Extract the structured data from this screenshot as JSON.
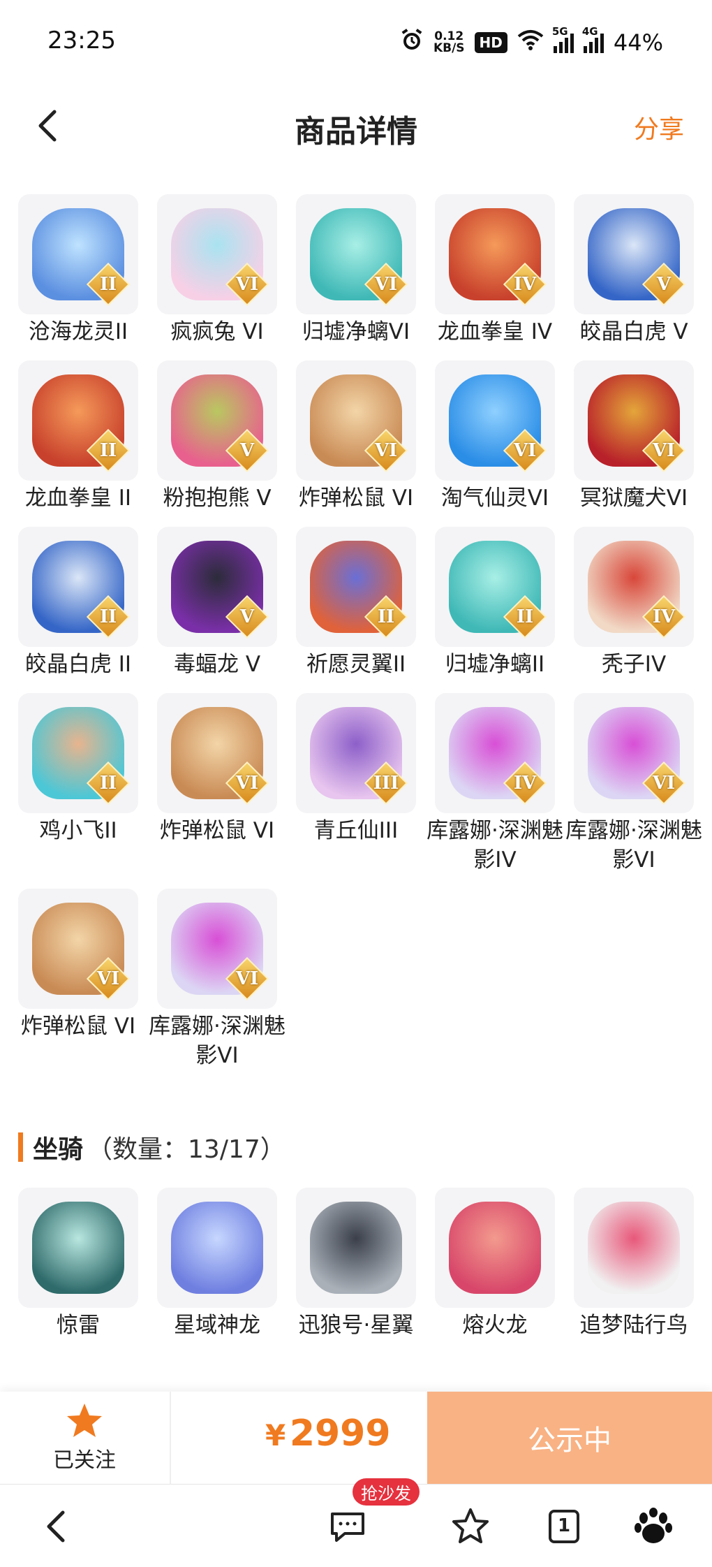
{
  "status_bar": {
    "time": "23:25",
    "net_speed_value": "0.12",
    "net_speed_unit": "KB/S",
    "hd_badge": "HD",
    "sig1_tag": "5G",
    "sig2_tag": "4G",
    "battery": "44%"
  },
  "header": {
    "title": "商品详情",
    "share_label": "分享"
  },
  "items": [
    {
      "label": "沧海龙灵II",
      "rank": "II",
      "colors": [
        "#5b8fe0",
        "#bfe3ff"
      ]
    },
    {
      "label": "疯疯兔 VI",
      "rank": "VI",
      "colors": [
        "#f7d0e6",
        "#a9e3f0"
      ]
    },
    {
      "label": "归墟净螭VI",
      "rank": "VI",
      "colors": [
        "#3fb8b6",
        "#a8efe6"
      ]
    },
    {
      "label": "龙血拳皇 IV",
      "rank": "IV",
      "colors": [
        "#c8412c",
        "#f59a5a"
      ]
    },
    {
      "label": "皎晶白虎 V",
      "rank": "V",
      "colors": [
        "#3566c7",
        "#dbe6f7"
      ]
    },
    {
      "label": "龙血拳皇 II",
      "rank": "II",
      "colors": [
        "#c8412c",
        "#f59a5a"
      ]
    },
    {
      "label": "粉抱抱熊 V",
      "rank": "V",
      "colors": [
        "#e8608e",
        "#b9c860"
      ]
    },
    {
      "label": "炸弹松鼠 VI",
      "rank": "VI",
      "colors": [
        "#c98b55",
        "#f3d5a8"
      ]
    },
    {
      "label": "淘气仙灵VI",
      "rank": "VI",
      "colors": [
        "#2a8de6",
        "#8fd0ff"
      ]
    },
    {
      "label": "冥狱魔犬VI",
      "rank": "VI",
      "colors": [
        "#b8202a",
        "#e4a63a"
      ]
    },
    {
      "label": "皎晶白虎 II",
      "rank": "II",
      "colors": [
        "#3566c7",
        "#dbe6f7"
      ]
    },
    {
      "label": "毒蝠龙 V",
      "rank": "V",
      "colors": [
        "#7a2fa8",
        "#2c2c3a"
      ]
    },
    {
      "label": "祈愿灵翼II",
      "rank": "II",
      "colors": [
        "#e0623a",
        "#6a6fd6"
      ]
    },
    {
      "label": "归墟净螭II",
      "rank": "II",
      "colors": [
        "#3fb8b6",
        "#a8efe6"
      ]
    },
    {
      "label": "秃子IV",
      "rank": "IV",
      "colors": [
        "#f1d9c6",
        "#d8473a"
      ]
    },
    {
      "label": "鸡小飞II",
      "rank": "II",
      "colors": [
        "#4cc7d6",
        "#e8b48e"
      ]
    },
    {
      "label": "炸弹松鼠 VI",
      "rank": "VI",
      "colors": [
        "#c98b55",
        "#f3d5a8"
      ]
    },
    {
      "label": "青丘仙III",
      "rank": "III",
      "colors": [
        "#e7c5ee",
        "#8c5fc9"
      ]
    },
    {
      "label": "库露娜·深渊魅影IV",
      "rank": "IV",
      "colors": [
        "#dcd6f4",
        "#d84fd6"
      ]
    },
    {
      "label": "库露娜·深渊魅影VI",
      "rank": "VI",
      "colors": [
        "#dcd6f4",
        "#d84fd6"
      ]
    },
    {
      "label": "炸弹松鼠 VI",
      "rank": "VI",
      "colors": [
        "#c98b55",
        "#f3d5a8"
      ]
    },
    {
      "label": "库露娜·深渊魅影VI",
      "rank": "VI",
      "colors": [
        "#dcd6f4",
        "#d84fd6"
      ]
    }
  ],
  "mounts_section": {
    "title": "坐骑",
    "count": "（数量：13/17）",
    "items": [
      {
        "label": "惊雷",
        "colors": [
          "#2f6b6b",
          "#b9e7e0"
        ]
      },
      {
        "label": "星域神龙",
        "colors": [
          "#6f7fe0",
          "#c7d7ff"
        ]
      },
      {
        "label": "迅狼号·星翼",
        "colors": [
          "#a9b0b8",
          "#3a3f4a"
        ]
      },
      {
        "label": "熔火龙",
        "colors": [
          "#d8476a",
          "#f39a8e"
        ]
      },
      {
        "label": "追梦陆行鸟",
        "colors": [
          "#f1f1f1",
          "#e8587a"
        ]
      }
    ]
  },
  "action_bar": {
    "follow_label": "已关注",
    "price_currency": "¥",
    "price_value": "2999",
    "status_label": "公示中"
  },
  "browser_nav": {
    "sofa_badge": "抢沙发",
    "tab_count": "1"
  },
  "colors": {
    "accent": "#f07a1f",
    "status_button": "#f9b284",
    "badge_red": "#e6313e"
  }
}
